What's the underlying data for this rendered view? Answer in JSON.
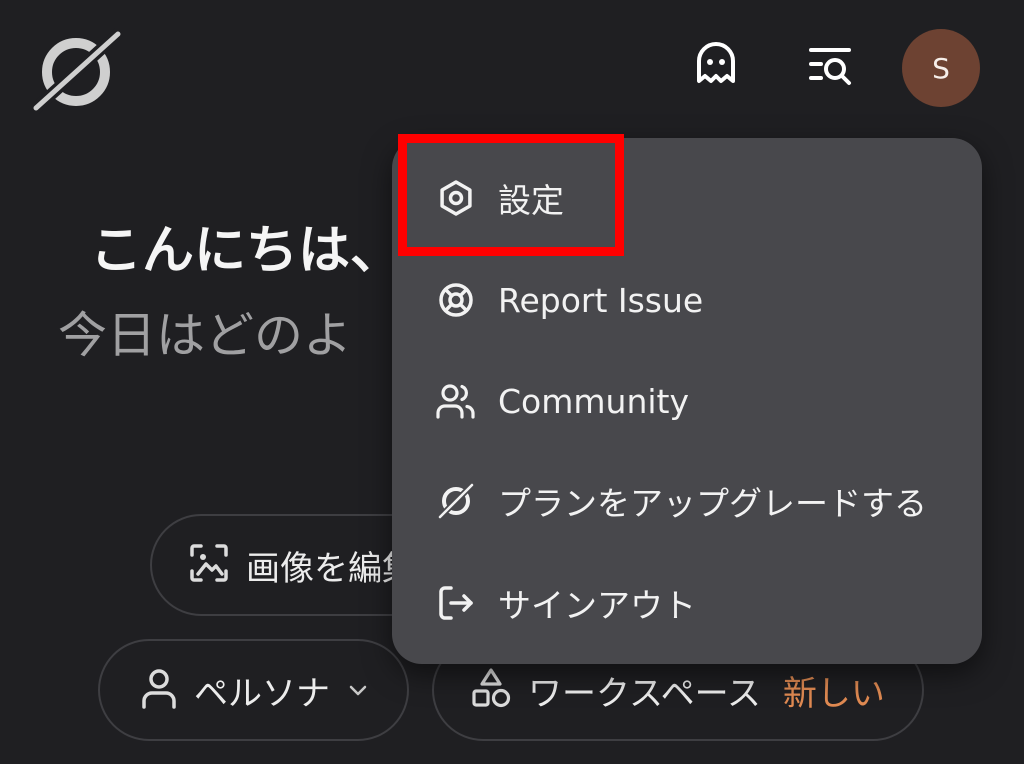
{
  "header": {
    "logo_icon": "perplexity-logo-icon",
    "ghost_icon": "ghost-icon",
    "history_icon": "list-search-icon",
    "avatar_initial": "S",
    "avatar_color": "#6d4232"
  },
  "greeting": {
    "line1": "こんにちは、",
    "line2": "今日はどのよ"
  },
  "pills": {
    "edit_image": {
      "icon": "image-scan-icon",
      "label": "画像を編集"
    },
    "persona": {
      "icon": "person-icon",
      "label": "ペルソナ",
      "caret_icon": "chevron-down-icon"
    },
    "workspace": {
      "icon": "shapes-icon",
      "label": "ワークスペース",
      "badge": "新しい",
      "badge_color": "#e08a52"
    }
  },
  "menu": {
    "items": [
      {
        "id": "settings",
        "icon": "gear-icon",
        "label": "設定",
        "highlighted": true
      },
      {
        "id": "report",
        "icon": "lifebuoy-icon",
        "label": "Report Issue"
      },
      {
        "id": "community",
        "icon": "users-icon",
        "label": "Community"
      },
      {
        "id": "upgrade",
        "icon": "perplexity-logo-icon",
        "label": "プランをアップグレードする"
      },
      {
        "id": "signout",
        "icon": "sign-out-icon",
        "label": "サインアウト"
      }
    ]
  },
  "colors": {
    "background": "#1f1f22",
    "menu_background": "#48484c",
    "highlight": "#ff0000"
  }
}
